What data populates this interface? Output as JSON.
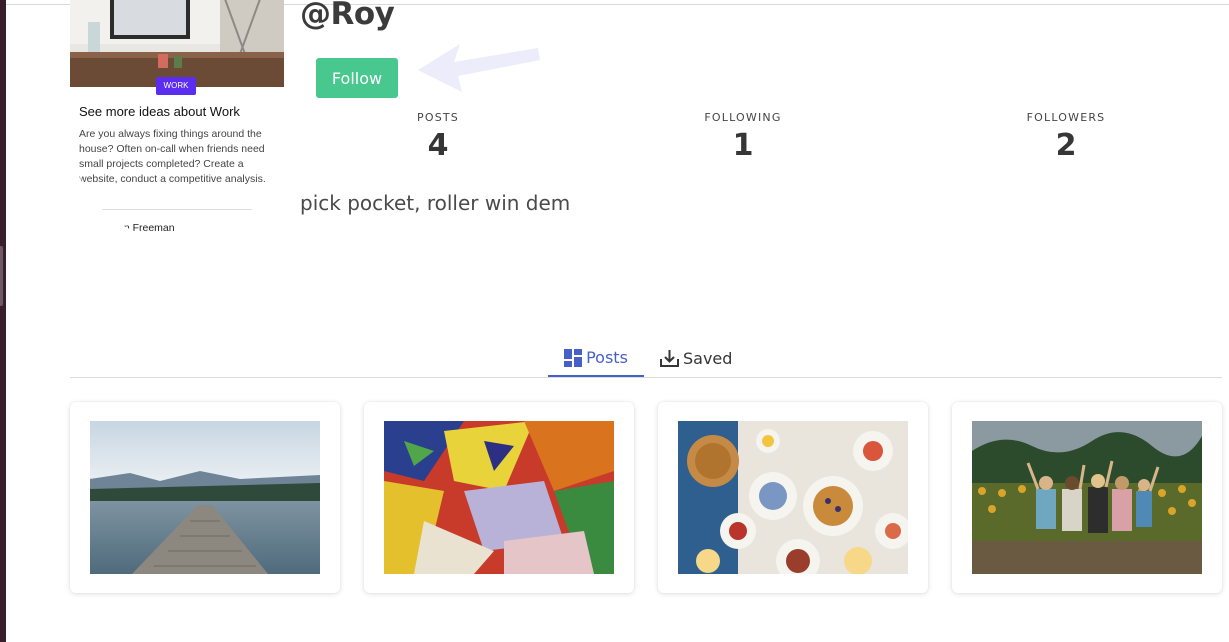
{
  "profile": {
    "username": "@Roy",
    "follow_label": "Follow",
    "bio": "pick pocket, roller win dem"
  },
  "avatar_card": {
    "badge": "WORK",
    "title": "See more ideas about Work",
    "text": "Are you always fixing things around the house? Often on-call when friends need small projects completed? Create a website, conduct a competitive analysis.",
    "author": "an Freeman"
  },
  "stats": [
    {
      "label": "POSTS",
      "value": "4"
    },
    {
      "label": "FOLLOWING",
      "value": "1"
    },
    {
      "label": "FOLLOWERS",
      "value": "2"
    }
  ],
  "tabs": {
    "posts": "Posts",
    "saved": "Saved"
  },
  "posts": [
    {
      "image": "lake-dock-photo"
    },
    {
      "image": "paint-colors-photo"
    },
    {
      "image": "breakfast-table-photo"
    },
    {
      "image": "sunflower-friends-photo"
    }
  ],
  "colors": {
    "follow_button": "#48c78e",
    "active_tab": "#485fc7",
    "badge": "#5b2df0"
  }
}
